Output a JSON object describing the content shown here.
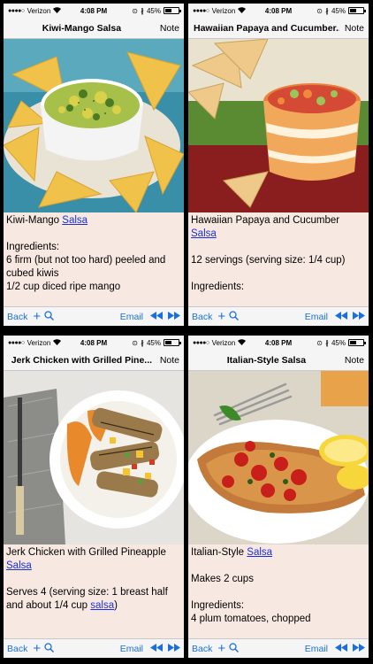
{
  "phones": [
    {
      "status": {
        "carrier": "Verizon",
        "time": "4:08 PM",
        "battery": "45%"
      },
      "nav": {
        "title": "Kiwi-Mango Salsa",
        "note": "Note"
      },
      "photo": "kiwi-mango salsa in white bowl with tortilla chips",
      "content": {
        "heading_text": "Kiwi-Mango ",
        "heading_link": "Salsa",
        "lines": [
          "Ingredients:",
          "6 firm (but not too hard) peeled and cubed kiwis",
          "1/2 cup diced ripe mango"
        ]
      },
      "toolbar": {
        "back": "Back",
        "email": "Email"
      }
    },
    {
      "status": {
        "carrier": "Verizon",
        "time": "4:08 PM",
        "battery": "45%"
      },
      "nav": {
        "title": "Hawaiian Papaya and Cucumber...",
        "note": "Note"
      },
      "photo": "papaya cucumber salsa in striped bowl with chips",
      "content": {
        "heading_text": "Hawaiian Papaya and Cucumber ",
        "heading_link": "Salsa",
        "lines": [
          "12 servings (serving size: 1/4 cup)",
          "Ingredients:"
        ]
      },
      "toolbar": {
        "back": "Back",
        "email": "Email"
      }
    },
    {
      "status": {
        "carrier": "Verizon",
        "time": "4:08 PM",
        "battery": "45%"
      },
      "nav": {
        "title": "Jerk Chicken with Grilled Pine...",
        "note": "Note"
      },
      "photo": "grilled jerk chicken with pineapple salsa on plate",
      "content": {
        "heading_text": "Jerk Chicken with Grilled Pineapple ",
        "heading_link": "Salsa",
        "line1": "Serves 4 (serving size: 1 breast half and about 1/4 cup ",
        "line1_link": "salsa",
        "line1_end": ")"
      },
      "toolbar": {
        "back": "Back",
        "email": "Email"
      }
    },
    {
      "status": {
        "carrier": "Verizon",
        "time": "4:08 PM",
        "battery": "45%"
      },
      "nav": {
        "title": "Italian-Style Salsa",
        "note": "Note"
      },
      "photo": "fish fillet topped with tomato salsa and lemon",
      "content": {
        "heading_text": "Italian-Style ",
        "heading_link": "Salsa",
        "lines": [
          "Makes 2 cups",
          "Ingredients:",
          "4 plum tomatoes, chopped"
        ]
      },
      "toolbar": {
        "back": "Back",
        "email": "Email"
      }
    }
  ],
  "colors": {
    "link": "#1a2fd8",
    "toolbar_tint": "#1a6fdc",
    "content_bg": "#f7e9e1"
  }
}
